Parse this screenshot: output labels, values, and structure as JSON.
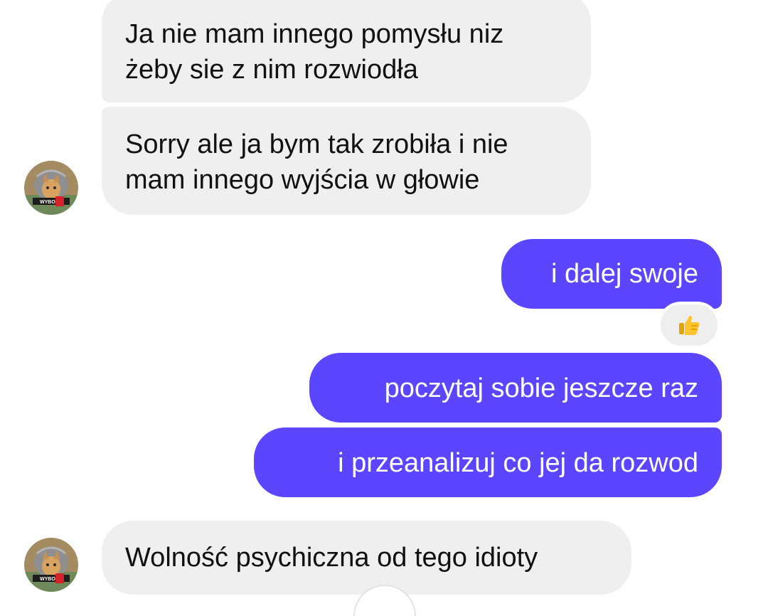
{
  "messages": [
    {
      "direction": "incoming",
      "lines": [
        "Ja nie mam innego pomysłu niz",
        "żeby sie z nim rozwiodła"
      ]
    },
    {
      "direction": "incoming",
      "lines": [
        "Sorry ale ja bym tak zrobiła i nie",
        "mam innego wyjścia w głowie"
      ]
    },
    {
      "direction": "outgoing",
      "text": "i dalej swoje",
      "reaction": "thumbs-up-icon"
    },
    {
      "direction": "outgoing",
      "text": "poczytaj sobie jeszcze raz"
    },
    {
      "direction": "outgoing",
      "text": "i przeanalizuj co jej da rozwod"
    },
    {
      "direction": "incoming",
      "text": "Wolność psychiczna od tego idioty"
    }
  ],
  "avatar": {
    "badge_text": "WYBOR"
  },
  "colors": {
    "outgoing_bubble": "#5c45ff",
    "incoming_bubble": "#efefef",
    "incoming_text": "#111111",
    "outgoing_text": "#ffffff",
    "reaction_bg": "#eeeeee"
  }
}
